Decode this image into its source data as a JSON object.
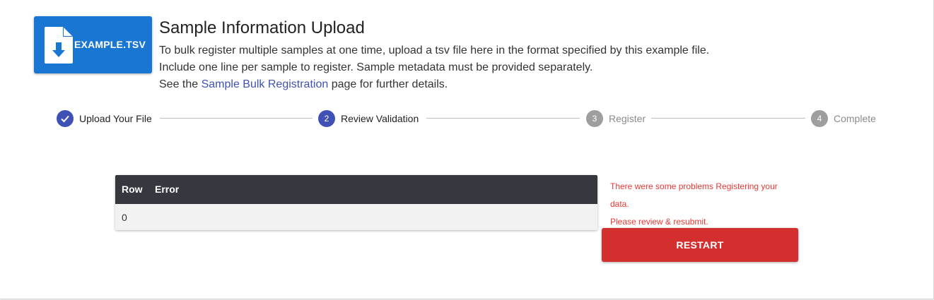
{
  "upload": {
    "example_button_label": "EXAMPLE.TSV",
    "example_icon": "file-download-icon",
    "title": "Sample Information Upload",
    "description_line1": "To bulk register multiple samples at one time, upload a tsv file here in the format specified by this example file.",
    "description_line2": "Include one line per sample to register. Sample metadata must be provided separately.",
    "description_line3_prefix": "See the ",
    "description_line3_link": "Sample Bulk Registration",
    "description_line3_suffix": " page for further details."
  },
  "stepper": {
    "steps": [
      {
        "number": "✓",
        "label": "Upload Your File",
        "state": "done"
      },
      {
        "number": "2",
        "label": "Review Validation",
        "state": "current"
      },
      {
        "number": "3",
        "label": "Register",
        "state": "pending"
      },
      {
        "number": "4",
        "label": "Complete",
        "state": "pending"
      }
    ]
  },
  "errors": {
    "columns": [
      "Row",
      "Error"
    ],
    "rows": [
      {
        "row": "0",
        "error": ""
      }
    ]
  },
  "status": {
    "message_line1": "There were some problems Registering your data.",
    "message_line2": "Please review & resubmit.",
    "restart_label": "RESTART"
  },
  "colors": {
    "primary": "#3f51b5",
    "example_button": "#1976d2",
    "error": "#d32f2f",
    "table_header": "#35383f",
    "inactive_step": "#9e9e9e"
  }
}
